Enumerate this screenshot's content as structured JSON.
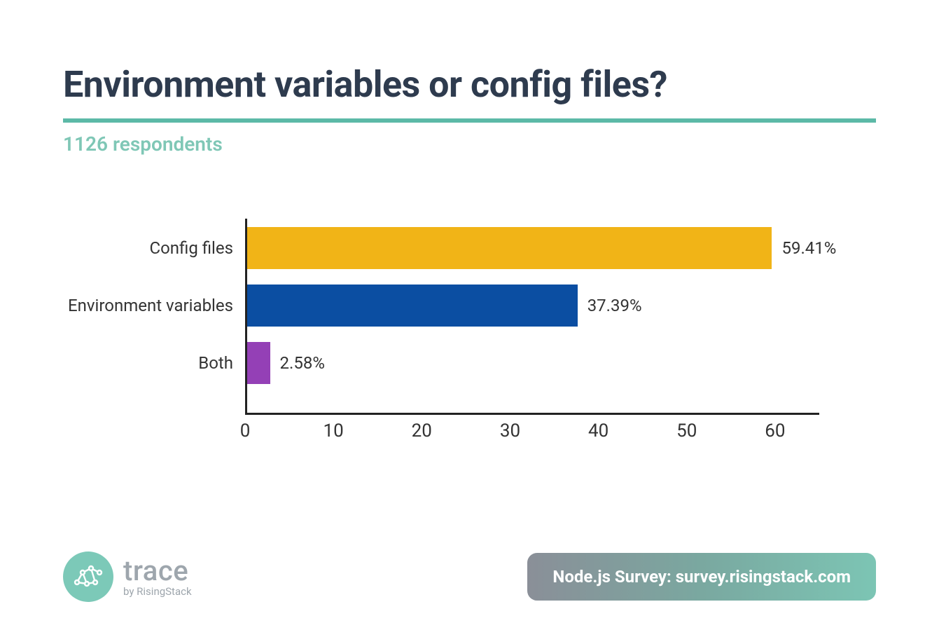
{
  "title": "Environment variables or config files?",
  "subtitle": "1126 respondents",
  "footer": {
    "logo_text": "trace",
    "logo_byline": "by RisingStack",
    "badge": "Node.js Survey: survey.risingstack.com"
  },
  "colors": {
    "accent": "#5cb9a7",
    "title": "#2e3b4e"
  },
  "chart_data": {
    "type": "bar",
    "orientation": "horizontal",
    "categories": [
      "Config files",
      "Environment variables",
      "Both"
    ],
    "values": [
      59.41,
      37.39,
      2.58
    ],
    "value_labels": [
      "59.41%",
      "37.39%",
      "2.58%"
    ],
    "bar_colors": [
      "#f1b417",
      "#0b4ea2",
      "#9440b6"
    ],
    "xticks": [
      0,
      10,
      20,
      30,
      40,
      50,
      60
    ],
    "xlim": [
      0,
      65
    ],
    "title": "Environment variables or config files?",
    "xlabel": "",
    "ylabel": ""
  }
}
